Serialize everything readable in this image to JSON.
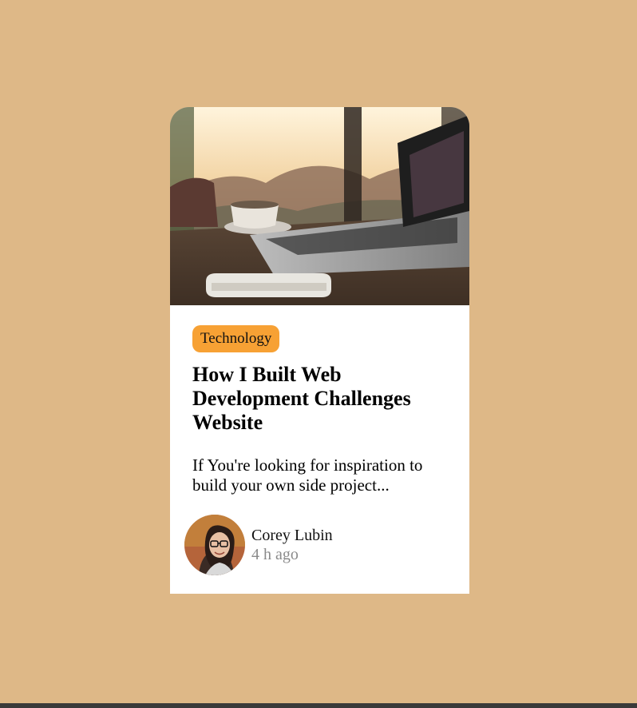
{
  "card": {
    "image_alt": "laptop-coffee-desk-photo",
    "tag": "Technology",
    "title": "How I Built Web Development Challenges Website",
    "excerpt": "If You're looking for inspiration to build your own side project...",
    "author": {
      "name": "Corey Lubin",
      "time": "4 h ago"
    }
  },
  "colors": {
    "page_background": "#deb887",
    "tag_background": "#f7a134",
    "card_background": "#ffffff",
    "muted_text": "#8a8a8a"
  }
}
